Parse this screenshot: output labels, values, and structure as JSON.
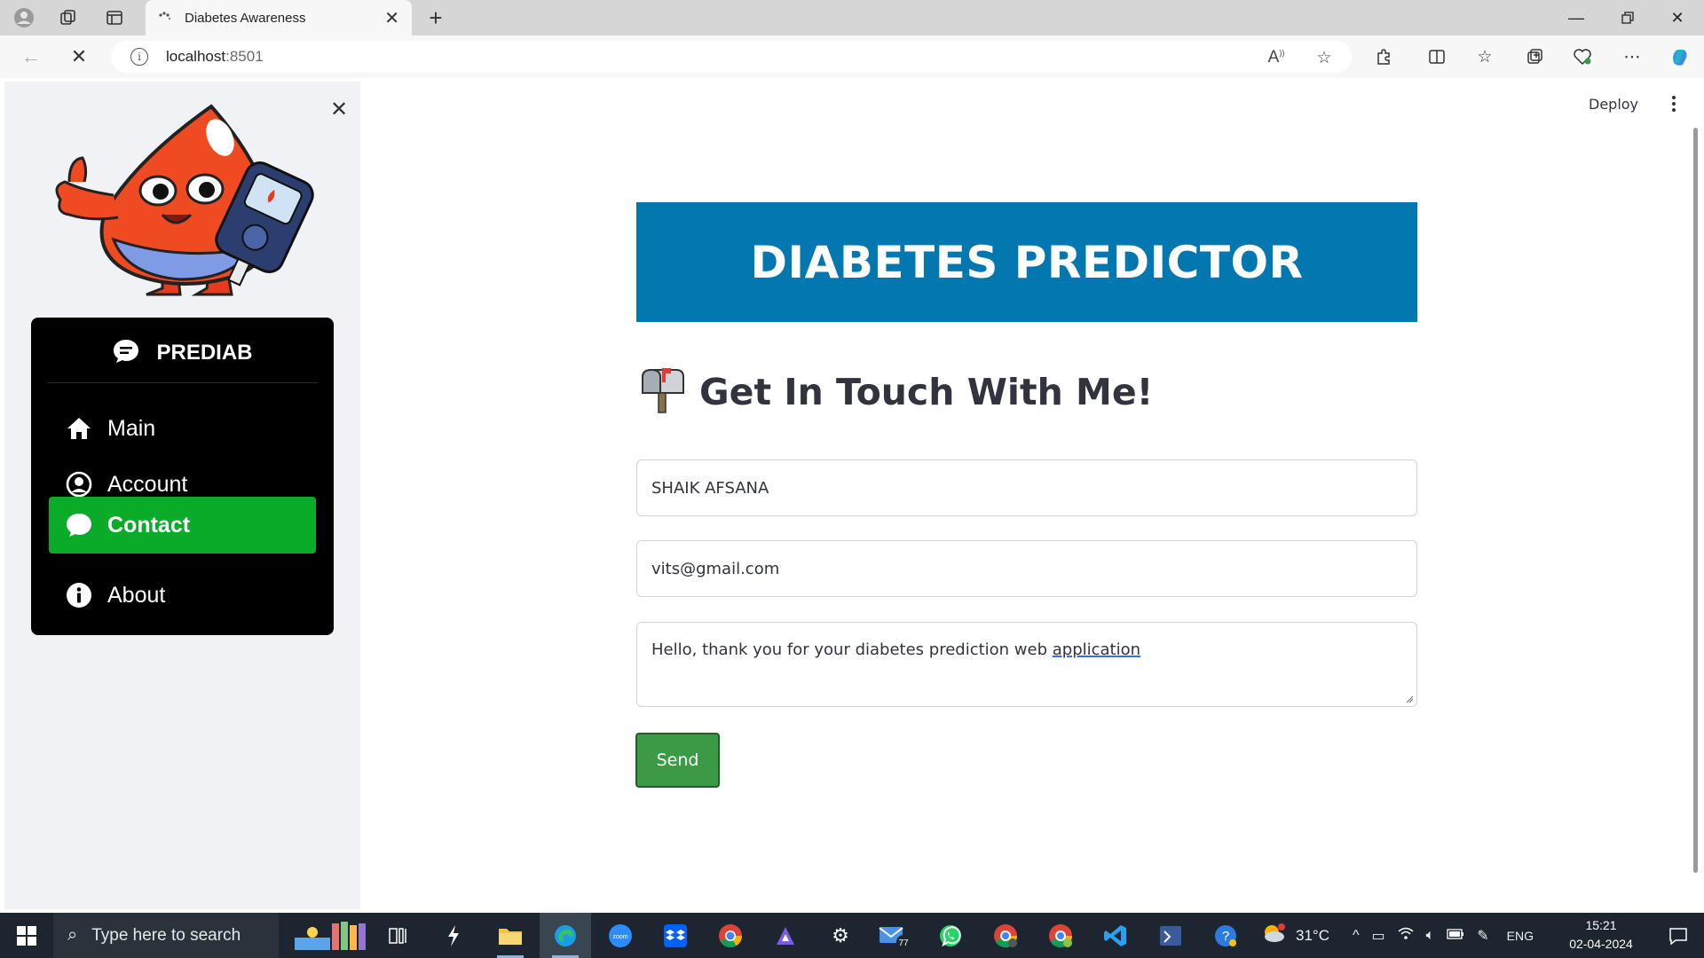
{
  "browser": {
    "tab_title": "Diabetes Awareness",
    "url_host": "localhost",
    "url_port": ":8501",
    "new_tab_label": "+"
  },
  "page": {
    "deploy_label": "Deploy",
    "banner_title": "DIABETES PREDICTOR",
    "contact_heading": "Get In Touch With Me!",
    "form": {
      "name_value": "SHAIK AFSANA",
      "email_value": "vits@gmail.com",
      "message_prefix": "Hello, thank you for your diabetes prediction web ",
      "message_underlined": "application",
      "send_label": "Send"
    }
  },
  "sidebar": {
    "menu_title": "PREDIAB",
    "items": [
      {
        "label": "Main",
        "icon": "house-icon",
        "active": false
      },
      {
        "label": "Account",
        "icon": "user-circle-icon",
        "active": false
      },
      {
        "label": "Contact",
        "icon": "chat-bubble-icon",
        "active": true
      },
      {
        "label": "About",
        "icon": "info-circle-icon",
        "active": false
      }
    ],
    "active_color": "#0aab28"
  },
  "taskbar": {
    "search_placeholder": "Type here to search",
    "temperature": "31°C",
    "language": "ENG",
    "time": "15:21",
    "date": "02-04-2024",
    "mail_badge": "77"
  },
  "colors": {
    "banner_bg": "#0277b0",
    "send_bg": "#3a9a46",
    "sidebar_bg": "#f0f2f6"
  }
}
